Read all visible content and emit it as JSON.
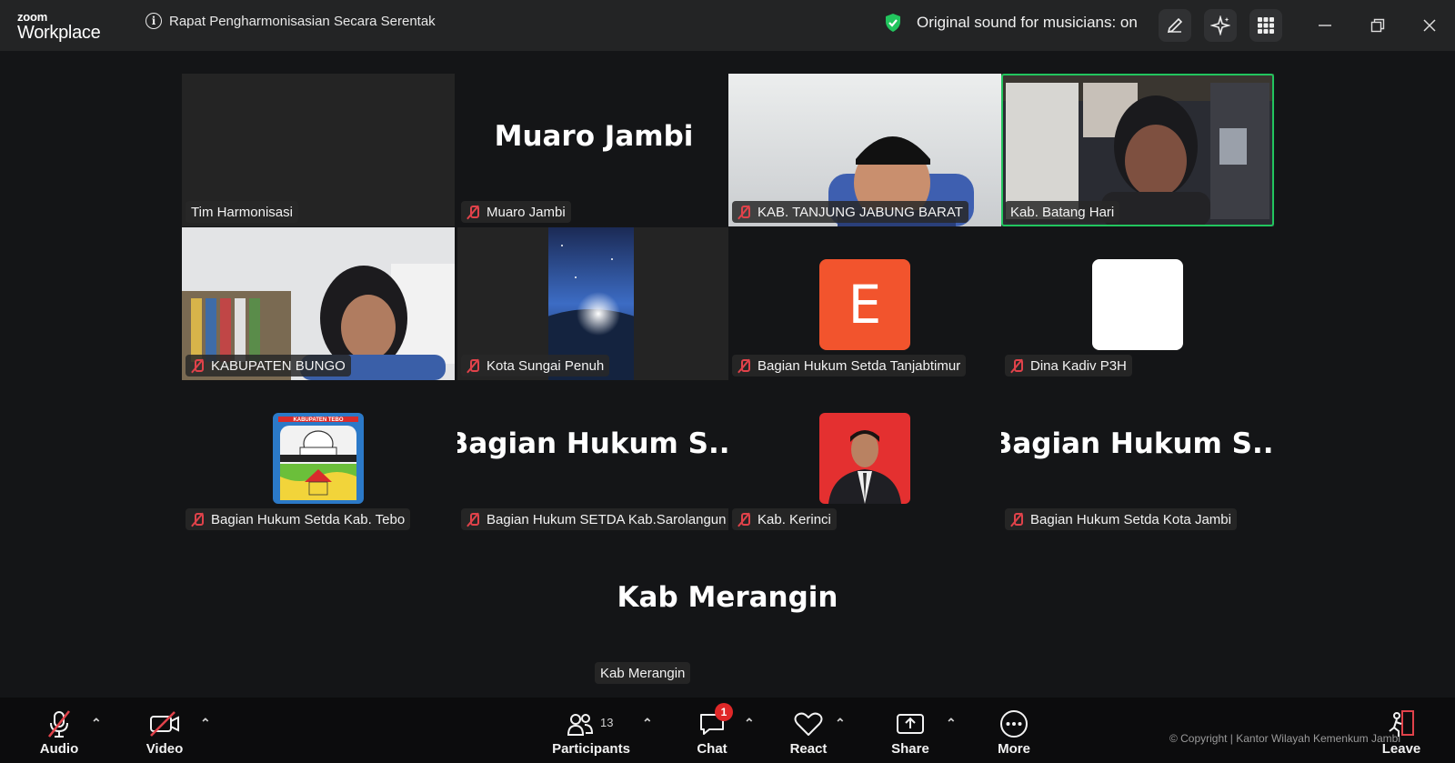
{
  "titlebar": {
    "logo_top": "zoom",
    "logo_bottom": "Workplace",
    "meeting_title": "Rapat Pengharmonisasian Secara Serentak",
    "sound_status": "Original sound for musicians: on",
    "icons": [
      "info-icon",
      "shield-check-icon",
      "pencil-icon",
      "sparkle-icon",
      "apps-grid-icon",
      "minimize-icon",
      "restore-icon",
      "close-icon"
    ]
  },
  "colors": {
    "accent_green": "#22c55e",
    "mute_red": "#e0424a",
    "avatar_orange": "#f2542d",
    "badge_red": "#e02828"
  },
  "participants": [
    {
      "name": "Tim Harmonisasi",
      "muted": false,
      "display": "blank"
    },
    {
      "name": "Muaro Jambi",
      "muted": true,
      "display": "name",
      "big_text": "Muaro Jambi"
    },
    {
      "name": "KAB. TANJUNG JABUNG BARAT",
      "muted": true,
      "display": "video"
    },
    {
      "name": "Kab. Batang Hari",
      "muted": false,
      "display": "video",
      "active_speaker": true
    },
    {
      "name": "KABUPATEN BUNGO",
      "muted": true,
      "display": "video"
    },
    {
      "name": "Kota Sungai Penuh",
      "muted": true,
      "display": "video"
    },
    {
      "name": "Bagian Hukum Setda Tanjabtimur",
      "muted": true,
      "display": "avatar",
      "avatar_letter": "E"
    },
    {
      "name": "Dina Kadiv P3H",
      "muted": true,
      "display": "avatar"
    },
    {
      "name": "Bagian Hukum Setda Kab. Tebo",
      "muted": true,
      "display": "logo",
      "logo_text": "KABUPATEN TEBO"
    },
    {
      "name": "Bagian Hukum SETDA Kab.Sarolangun",
      "muted": true,
      "display": "name",
      "big_text": "Bagian Hukum S..."
    },
    {
      "name": "Kab. Kerinci",
      "muted": true,
      "display": "photo"
    },
    {
      "name": "Bagian Hukum Setda Kota Jambi",
      "muted": true,
      "display": "name",
      "big_text": "Bagian Hukum S..."
    },
    {
      "name": "Kab Merangin",
      "muted": false,
      "display": "name",
      "big_text": "Kab Merangin"
    }
  ],
  "toolbar": {
    "audio": "Audio",
    "video": "Video",
    "participants": "Participants",
    "participant_count": "13",
    "chat": "Chat",
    "chat_badge": "1",
    "react": "React",
    "share": "Share",
    "more": "More",
    "leave": "Leave",
    "copyright": "© Copyright | Kantor Wilayah Kemenkum Jambi"
  }
}
